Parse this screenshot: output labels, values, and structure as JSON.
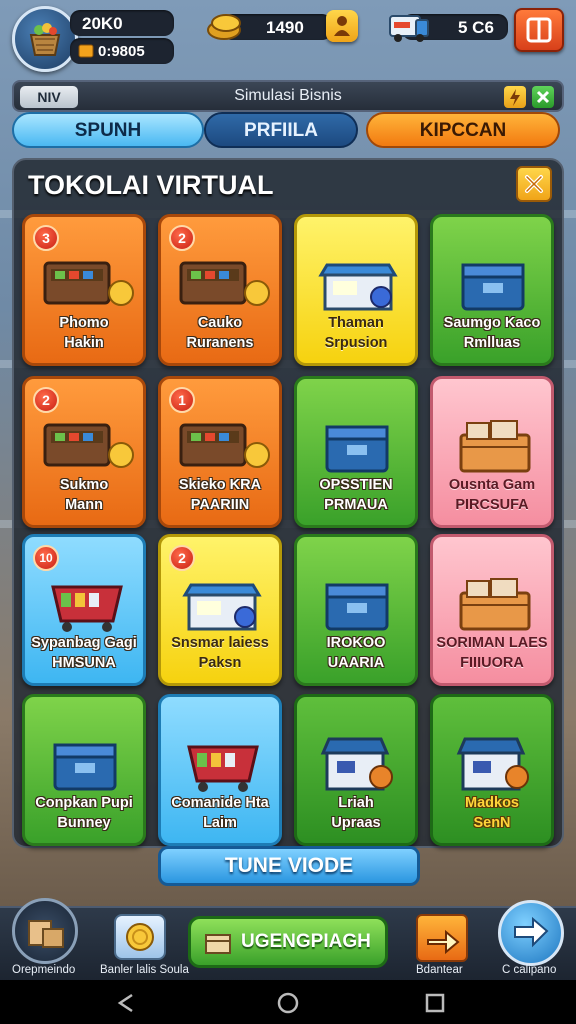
{
  "hud": {
    "stat1": "20K0",
    "stat2": "0:9805",
    "coins": "1490",
    "resources": "5 C6"
  },
  "titlebar": {
    "badge": "NIV",
    "title": "Simulasi Bisnis"
  },
  "tabs": [
    {
      "label": "SPUNH",
      "state": "active"
    },
    {
      "label": "PRFIILA",
      "state": "inactive"
    },
    {
      "label": "KIPCCAN",
      "state": "highlight"
    }
  ],
  "panel": {
    "title": "TOKOLAI VIRTUAL",
    "close_icon": "close-icon"
  },
  "cards": [
    {
      "label": "Phomo\nHakin",
      "badge": "3",
      "color": "orange",
      "icon": "crate-of-goods-icon"
    },
    {
      "label": "Cauko\nRuranens",
      "badge": "2",
      "color": "orange",
      "icon": "shop-building-icon"
    },
    {
      "label": "Thaman\nSrpusion",
      "badge": "",
      "color": "yellow",
      "icon": "kiosk-icon"
    },
    {
      "label": "Saumgo Kaco\nRmlluas",
      "badge": "",
      "color": "green",
      "icon": "delivery-truck-icon"
    },
    {
      "label": "Sukmo\nMann",
      "badge": "2",
      "color": "orange",
      "icon": "produce-crate-icon"
    },
    {
      "label": "Skieko KRA\nPAARIIN",
      "badge": "1",
      "color": "orange",
      "icon": "shopping-cart-icon"
    },
    {
      "label": "OPSSTIEN\nPRMAUA",
      "badge": "",
      "color": "green",
      "icon": "storage-box-icon"
    },
    {
      "label": "Ousnta Gam\nPIRCSUFA",
      "badge": "",
      "color": "pink",
      "icon": "parcel-crate-icon"
    },
    {
      "label": "Sypanbag Gagi\nHMSUNA",
      "badge": "10",
      "color": "blue",
      "icon": "goods-basket-icon"
    },
    {
      "label": "Snsmar laiess\nPaksn",
      "badge": "2",
      "color": "yellow",
      "icon": "cart-icon"
    },
    {
      "label": "IROKOO\nUAARIA",
      "badge": "",
      "color": "green",
      "icon": "cardboard-box-icon"
    },
    {
      "label": "SORIMAN LAES\nFIIIUORA",
      "badge": "",
      "color": "pink",
      "icon": "recycle-cart-icon"
    },
    {
      "label": "Conpkan Pupi\nBunney",
      "badge": "",
      "color": "green",
      "icon": "gift-box-icon"
    },
    {
      "label": "Comanide Hta\nLaim",
      "badge": "",
      "color": "blue",
      "icon": "cart-icon"
    },
    {
      "label": "Lriah\nUpraas",
      "badge": "",
      "color": "darkgreen",
      "icon": "vendor-stand-icon"
    },
    {
      "label": "Madkos\nSenN",
      "badge": "",
      "color": "darkgreen",
      "icon": "stall-icon"
    }
  ],
  "tune_button": "TUNE VIODE",
  "bottombar": {
    "left_label": "Orepmeindo",
    "second_label": "Banler lalis Soula",
    "main_button": "UGENGPIAGH",
    "fourth_label": "Bdantear",
    "right_label": "C calipano"
  },
  "colors": {
    "orange": "#f07a1e",
    "yellow": "#f6d20f",
    "green": "#3aa12a",
    "pink": "#f58ea0",
    "blue": "#3eb6f2"
  }
}
